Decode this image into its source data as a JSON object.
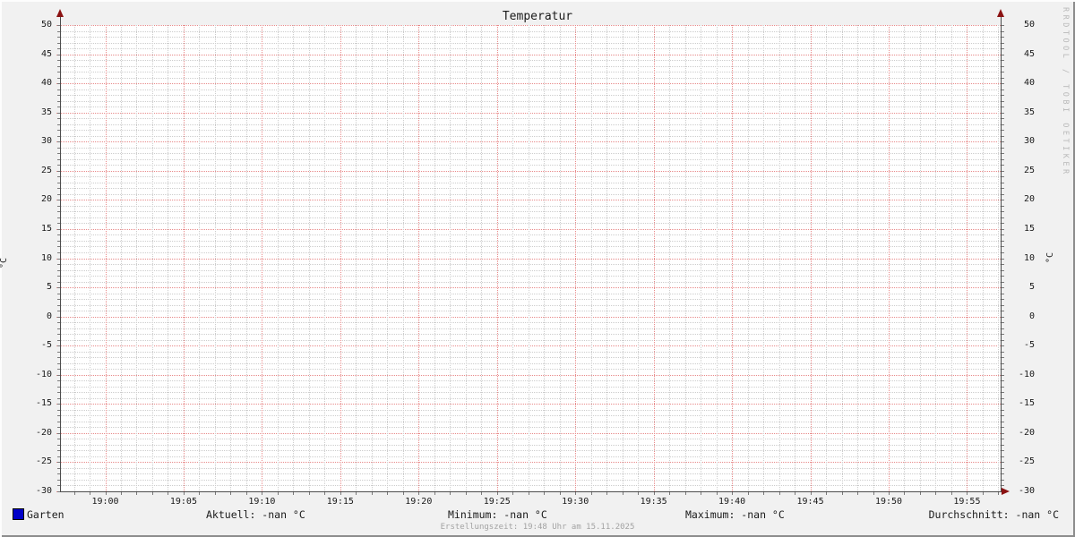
{
  "window": {
    "title": "Temperatur"
  },
  "chart_data": {
    "type": "line",
    "title": "Temperatur",
    "ylabel_left": "°C",
    "ylabel_right": "°C",
    "ylim": [
      -30,
      50
    ],
    "y_major_step": 5,
    "y_minor_step": 1,
    "x_ticks": [
      "19:00",
      "19:05",
      "19:10",
      "19:15",
      "19:20",
      "19:25",
      "19:30",
      "19:35",
      "19:40",
      "19:45",
      "19:50",
      "19:55"
    ],
    "x_minutes_per_major": 5,
    "grid": true,
    "legend_position": "bottom",
    "series": [
      {
        "name": "Garten",
        "color": "#0000c8",
        "values": []
      }
    ],
    "stats": {
      "aktuell": "-nan °C",
      "minimum": "-nan °C",
      "maximum": "-nan °C",
      "durchschnitt": "-nan °C"
    },
    "colors": {
      "canvas": "#ffffff",
      "background": "#f1f1f1",
      "grid_minor": "#cdcdcd",
      "grid_major": "#e88a8a",
      "axis": "#4d4d4d",
      "arrow": "#8b1212",
      "watermark": "#b9b9b9",
      "series_garten": "#0000c8"
    }
  },
  "legend": {
    "series_label": "Garten",
    "aktuell": "Aktuell: -nan °C",
    "minimum": "Minimum: -nan °C",
    "maximum": "Maximum: -nan °C",
    "durchschnitt": "Durchschnitt: -nan °C"
  },
  "footer": {
    "erstellungszeit": "Erstellungszeit: 19:48 Uhr am 15.11.2025"
  },
  "watermark": "RRDTOOL / TOBI OETIKER"
}
